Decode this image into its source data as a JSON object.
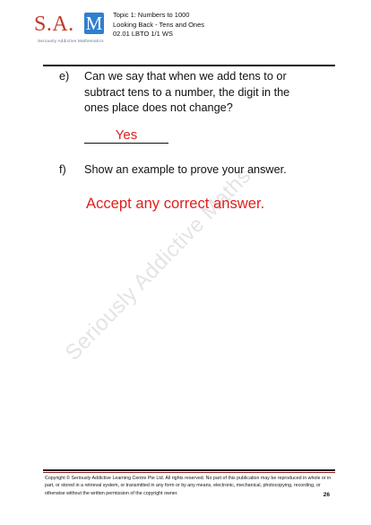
{
  "logo": {
    "letters": "S.A.",
    "m_letter": "M",
    "tagline": "Seriously Addictive Mathematics"
  },
  "header": {
    "lines": [
      "Topic 1: Numbers to 1000",
      "Looking Back  - Tens and Ones",
      "02.01 LBTO 1/1 WS"
    ]
  },
  "questions": [
    {
      "letter": "e)",
      "text": "Can we say that when we add tens to or subtract tens to a number, the digit in the ones place does not change?",
      "answer": "Yes"
    },
    {
      "letter": "f)",
      "text": "Show an example to prove your answer.",
      "answer": "Accept any correct answer."
    }
  ],
  "watermark": "Seriously Addictive Maths",
  "footer": {
    "copyright": "Copyright © Seriously Addictive Learning Centre Pte Ltd. All rights reserved. No part of this publication may be reproduced in whole or in part, or stored in a retrieval system, or transmitted in any form or by any means, electronic, mechanical, photocopying, recording, or otherwise without the written permission of the copyright owner.",
    "page_number": "26"
  },
  "colors": {
    "answer_red": "#e0201c",
    "logo_red": "#c0392b",
    "logo_blue": "#2f7fd1"
  }
}
